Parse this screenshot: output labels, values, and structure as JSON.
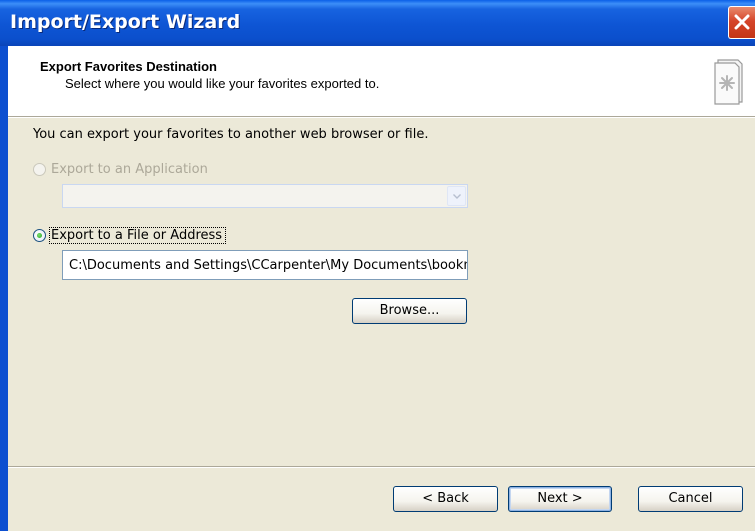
{
  "window": {
    "title": "Import/Export Wizard"
  },
  "header": {
    "title": "Export Favorites Destination",
    "subtitle": "Select where you would like your favorites exported to."
  },
  "body": {
    "intro": "You can export your favorites to another web browser or file.",
    "option_application": {
      "label": "Export to an Application",
      "selected": false,
      "enabled": false
    },
    "application_dropdown": {
      "value": ""
    },
    "option_file": {
      "label": "Export to a File or Address",
      "selected": true,
      "enabled": true
    },
    "file_path": "C:\\Documents and Settings\\CCarpenter\\My Documents\\bookm",
    "browse_label": "Browse..."
  },
  "footer": {
    "back_label": "< Back",
    "next_label": "Next >",
    "cancel_label": "Cancel"
  },
  "icons": {
    "close": "close-icon",
    "header": "favorites-page-icon",
    "dropdown": "chevron-down-icon"
  },
  "colors": {
    "titlebar": "#0b4fcc",
    "close_button": "#d5452a",
    "dialog_bg": "#ece9d8",
    "radio_selected": "#21a121"
  }
}
